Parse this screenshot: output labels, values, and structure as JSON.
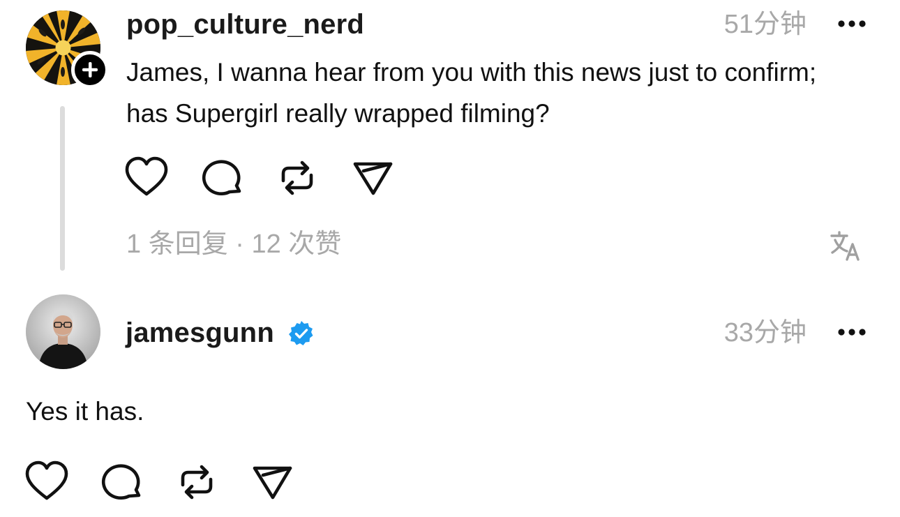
{
  "comment": {
    "username": "pop_culture_nerd",
    "time": "51分钟",
    "text": "James, I wanna hear from you with this news just to confirm; has Supergirl really wrapped filming?",
    "stats": "1 条回复 · 12 次赞",
    "avatar_icon": "yellow-black-starburst-avatar",
    "follow_icon": "plus-icon"
  },
  "reply": {
    "username": "jamesgunn",
    "verified": true,
    "verified_color": "#1d9bf0",
    "time": "33分钟",
    "text": "Yes it has."
  },
  "action_icons": [
    "heart-icon",
    "comment-icon",
    "repost-icon",
    "share-icon"
  ],
  "translate_icon": "translate-icon",
  "more_icon": "more-icon"
}
